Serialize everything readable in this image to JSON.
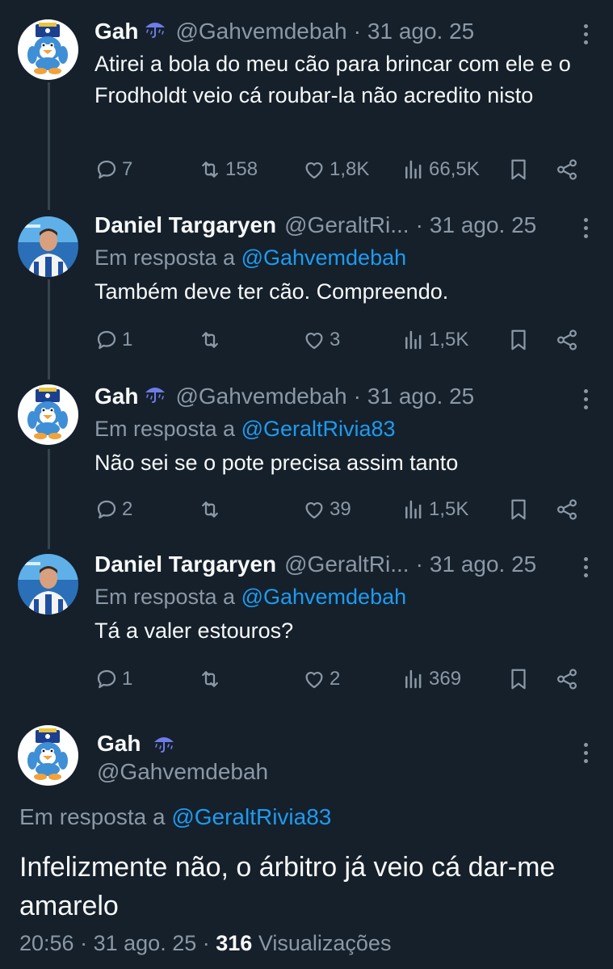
{
  "colors": {
    "background": "#15202b",
    "text": "#f7f9f9",
    "muted": "#8b98a5",
    "link": "#1d9bf0",
    "thread_line": "#38444d"
  },
  "tweets": [
    {
      "name": "Gah",
      "handle": "@Gahvemdebah",
      "sep": "·",
      "date": "31 ago. 25",
      "text": "Atirei a bola do meu cão para brincar com ele e o Frodholdt veio cá roubar-la não acredito nisto",
      "replies": "7",
      "retweets": "158",
      "likes": "1,8K",
      "views": "66,5K"
    },
    {
      "name": "Daniel Targaryen",
      "handle": "@GeraltRi...",
      "sep": "·",
      "date": "31 ago. 25",
      "reply_prefix": "Em resposta a",
      "reply_mention": "@Gahvemdebah",
      "text": "Também deve ter cão. Compreendo.",
      "replies": "1",
      "retweets": "",
      "likes": "3",
      "views": "1,5K"
    },
    {
      "name": "Gah",
      "handle": "@Gahvemdebah",
      "sep": "·",
      "date": "31 ago. 25",
      "reply_prefix": "Em resposta a",
      "reply_mention": "@GeraltRivia83",
      "text": "Não sei se o pote precisa assim tanto",
      "replies": "2",
      "retweets": "",
      "likes": "39",
      "views": "1,5K"
    },
    {
      "name": "Daniel Targaryen",
      "handle": "@GeraltRi...",
      "sep": "·",
      "date": "31 ago. 25",
      "reply_prefix": "Em resposta a",
      "reply_mention": "@Gahvemdebah",
      "text": "Tá a valer estouros?",
      "replies": "1",
      "retweets": "",
      "likes": "2",
      "views": "369"
    }
  ],
  "main": {
    "name": "Gah",
    "handle": "@Gahvemdebah",
    "reply_prefix": "Em resposta a",
    "reply_mention": "@GeraltRivia83",
    "text": "Infelizmente não, o árbitro já veio cá dar-me amarelo",
    "time": "20:56",
    "sep": "·",
    "date": "31 ago. 25",
    "views_count": "316",
    "views_label": "Visualizações"
  },
  "icons": {
    "reply": "reply-icon",
    "retweet": "retweet-icon",
    "like": "heart-icon",
    "views": "analytics-icon",
    "bookmark": "bookmark-icon",
    "share": "share-icon",
    "more": "more-dots-icon",
    "badge": "umbrella-rain-icon"
  }
}
